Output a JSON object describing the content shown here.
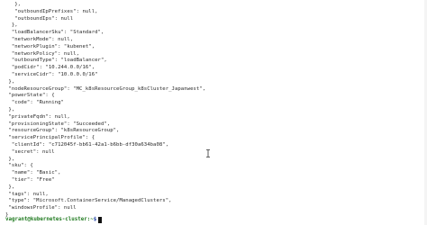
{
  "terminal": {
    "lines": [
      "   },",
      "   \"outboundIpPrefixes\": null,",
      "   \"outboundIps\": null",
      "  },",
      "  \"loadBalancerSku\": \"Standard\",",
      "  \"networkMode\": null,",
      "  \"networkPlugin\": \"kubenet\",",
      "  \"networkPolicy\": null,",
      "  \"outboundType\": \"loadBalancer\",",
      "  \"podCidr\": \"10.244.0.0/16\",",
      "  \"serviceCidr\": \"10.0.0.0/16\"",
      " },",
      " \"nodeResourceGroup\": \"MC_k8sResourceGroup_k8sCluster_Japanwest\",",
      " \"powerState\": {",
      "  \"code\": \"Running\"",
      " },",
      " \"privateFqdn\": null,",
      " \"provisioningState\": \"Succeeded\",",
      " \"resourceGroup\": \"k8sResourceGroup\",",
      " \"servicePrincipalProfile\": {",
      "  \"clientId\": \"c712045f-bb61-42a1-b6bb-df30a634ba08\",",
      "  \"secret\": null",
      " },",
      " \"sku\": {",
      "  \"name\": \"Basic\",",
      "  \"tier\": \"Free\"",
      " },",
      " \"tags\": null,",
      " \"type\": \"Microsoft.ContainerService/ManagedClusters\",",
      " \"windowsProfile\": null",
      "}"
    ],
    "prompt": {
      "user_host": "vagrant@kubernetes-cluster:~",
      "symbol": "$"
    }
  },
  "icons": {
    "mouse_cursor": "i-beam-cursor-icon"
  },
  "colors": {
    "background": "#ffffff",
    "text": "#2a2a2a",
    "prompt_user": "#1f7a1f",
    "prompt_symbol": "#1f3fa8"
  }
}
